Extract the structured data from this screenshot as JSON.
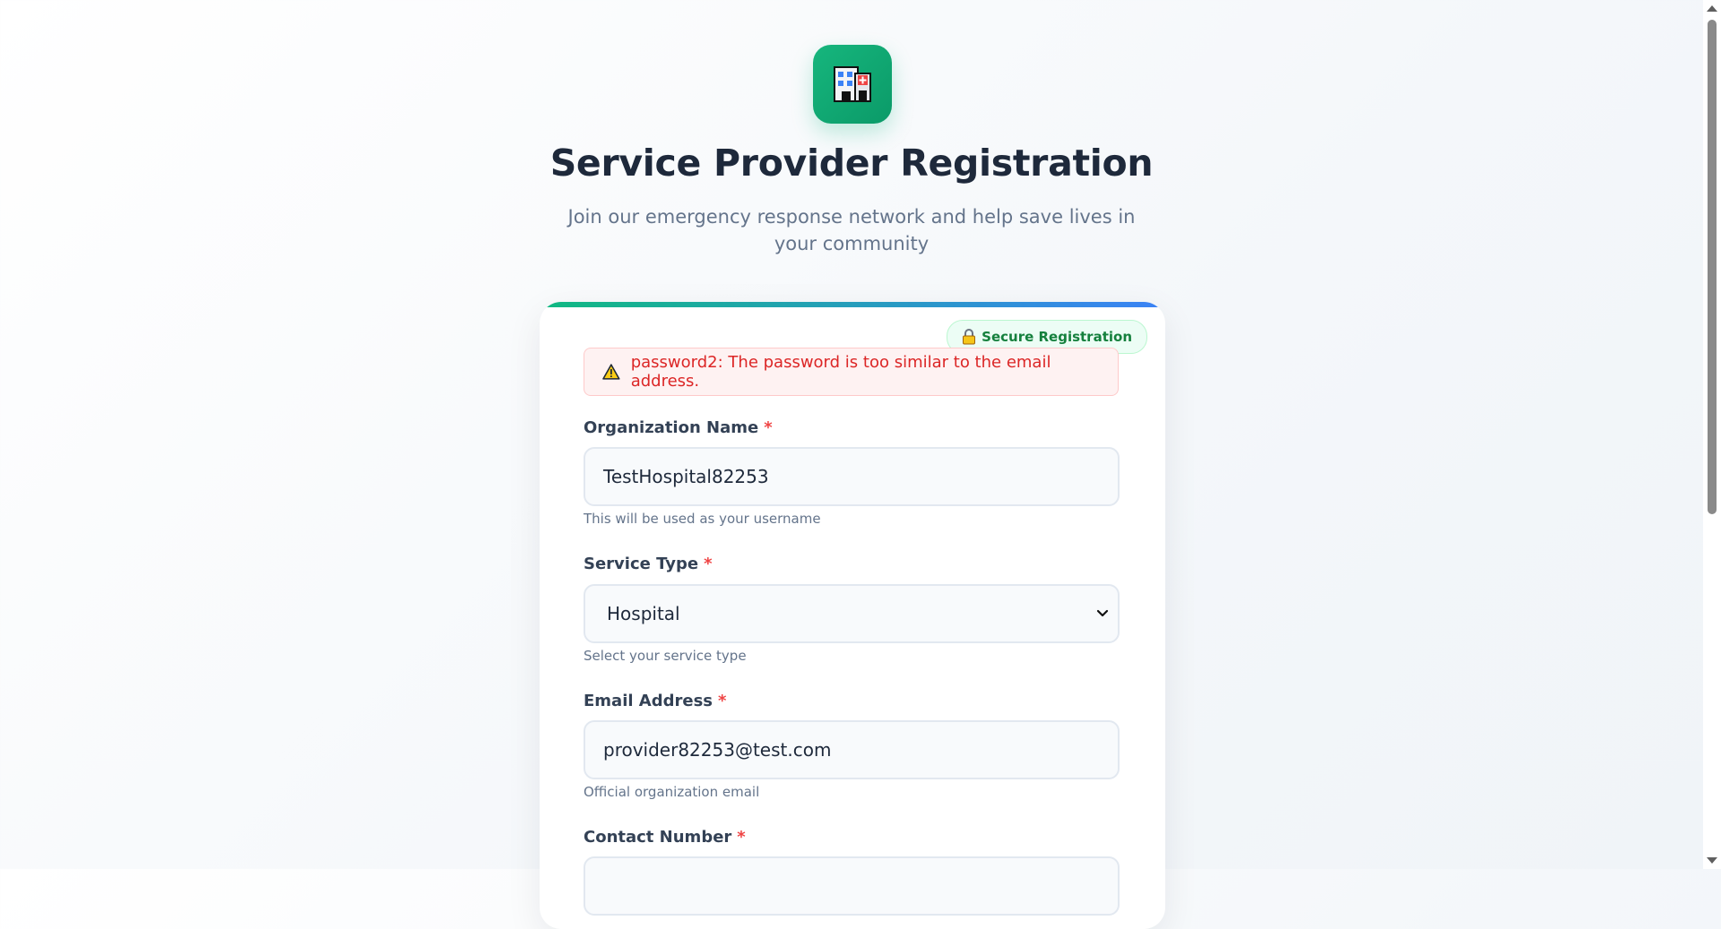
{
  "header": {
    "logo_icon": "hospital-icon",
    "title": "Service Provider Registration",
    "subtitle": "Join our emergency response network and help save lives in your community"
  },
  "card": {
    "badge": {
      "icon": "lock-icon",
      "label": "Secure Registration"
    },
    "alert": {
      "icon": "warning-icon",
      "message": "password2: The password is too similar to the email address."
    },
    "fields": {
      "organization_name": {
        "label": "Organization Name",
        "required_mark": "*",
        "value": "TestHospital82253",
        "help": "This will be used as your username"
      },
      "service_type": {
        "label": "Service Type",
        "required_mark": "*",
        "value": "Hospital",
        "help": "Select your service type"
      },
      "email": {
        "label": "Email Address",
        "required_mark": "*",
        "value": "provider82253@test.com",
        "help": "Official organization email"
      },
      "contact_number": {
        "label": "Contact Number",
        "required_mark": "*"
      }
    }
  },
  "colors": {
    "accent_green": "#10b981",
    "accent_blue": "#3b82f6",
    "error_red": "#dc2626",
    "required_red": "#ef4444"
  }
}
